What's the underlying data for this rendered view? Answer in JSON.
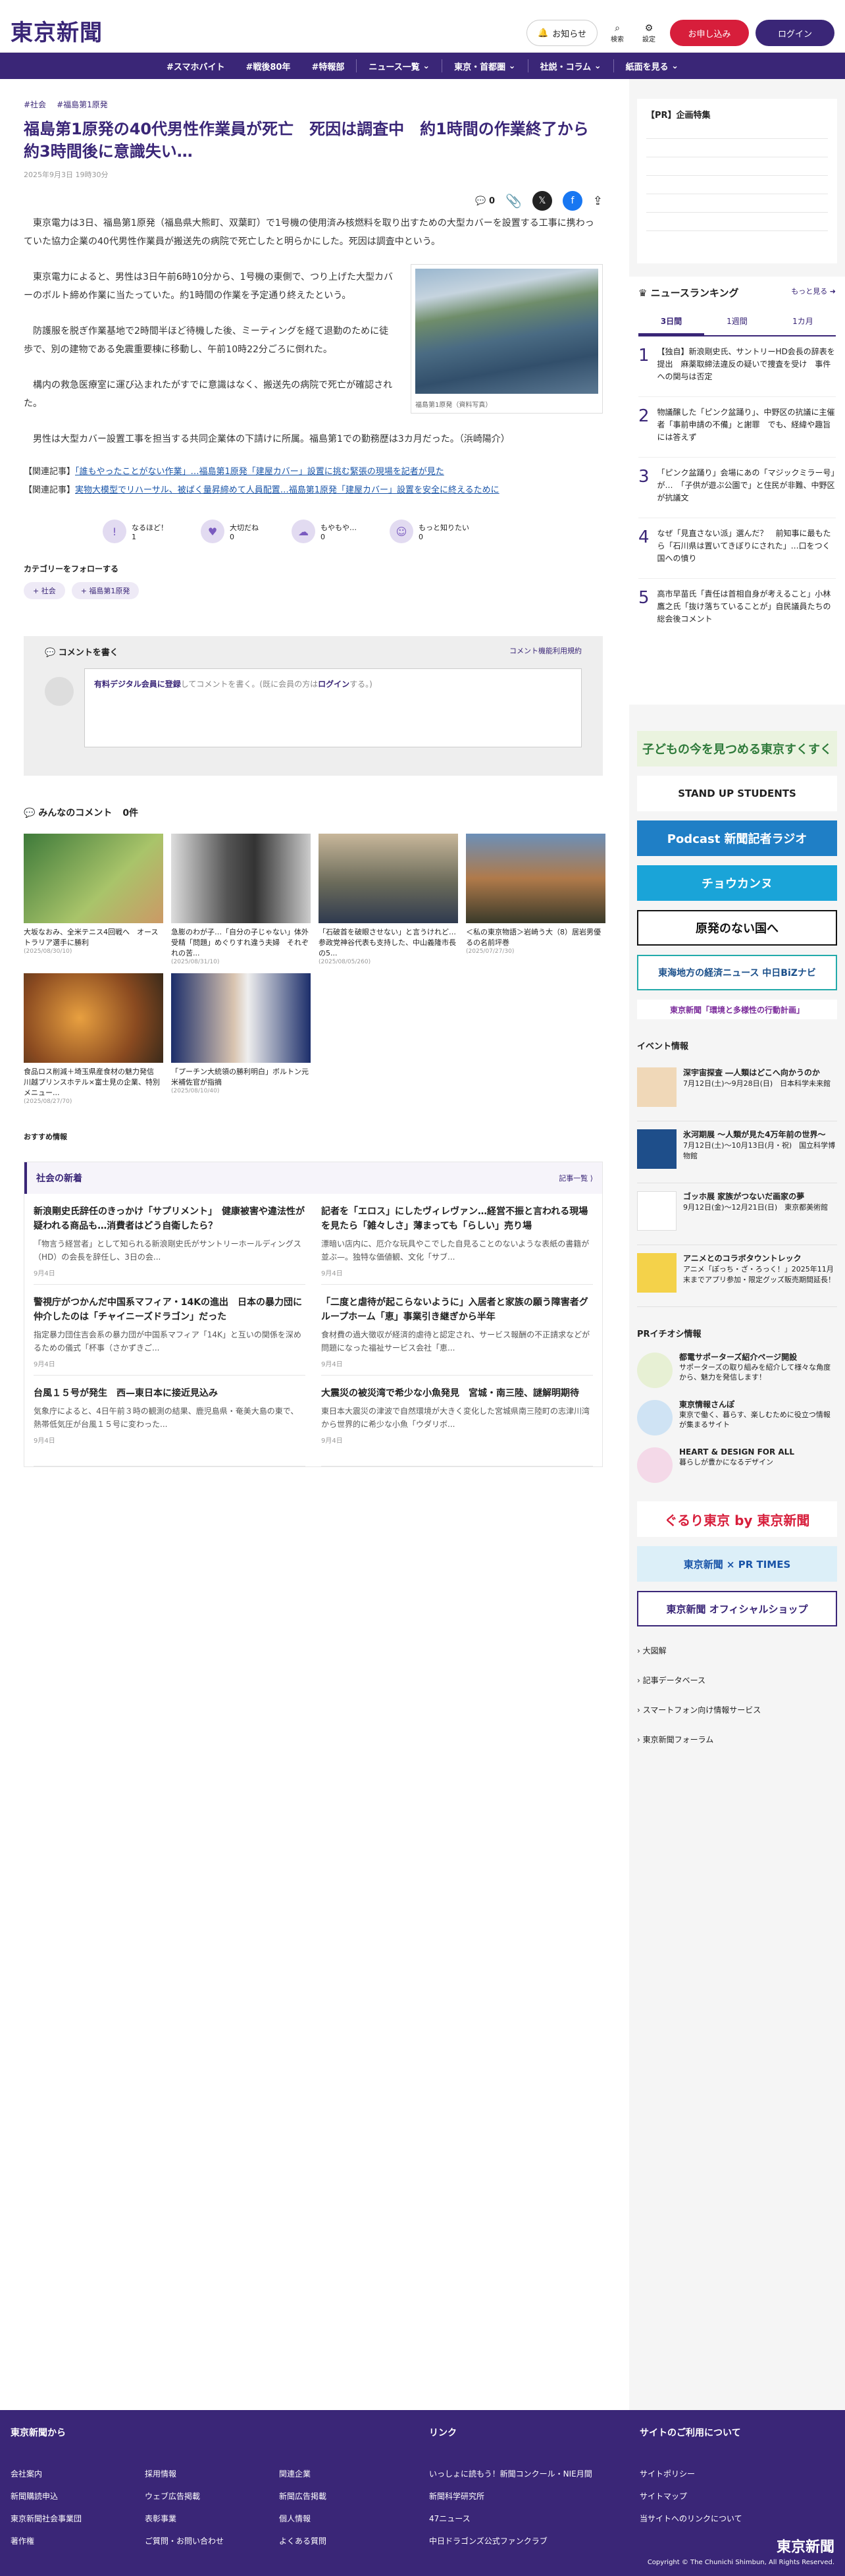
{
  "header": {
    "notif": "お知らせ",
    "search": "検索",
    "settings": "設定",
    "signup": "お申し込み",
    "login": "ログイン",
    "logo": "東京新聞"
  },
  "nav": [
    "#スマホバイト",
    "#戦後80年",
    "#特報部",
    "ニュース一覧",
    "東京・首都圏",
    "社説・コラム",
    "紙面を見る"
  ],
  "article": {
    "tags": [
      "#社会",
      "#福島第1原発"
    ],
    "title": "福島第1原発の40代男性作業員が死亡　死因は調査中　約1時間の作業終了から約3時間後に意識失い…",
    "date": "2025年9月3日 19時30分",
    "comment_count": "0",
    "p": [
      "東京電力は3日、福島第1原発（福島県大熊町、双葉町）で1号機の使用済み核燃料を取り出すための大型カバーを設置する工事に携わっていた協力企業の40代男性作業員が搬送先の病院で死亡したと明らかにした。死因は調査中という。",
      "東京電力によると、男性は3日午前6時10分から、1号機の東側で、つり上げた大型カバーのボルト締め作業に当たっていた。約1時間の作業を予定通り終えたという。",
      "防護服を脱ぎ作業基地で2時間半ほど待機した後、ミーティングを経て退勤のために徒歩で、別の建物である免震重要棟に移動し、午前10時22分ごろに倒れた。",
      "構内の救急医療室に運び込まれたがすでに意識はなく、搬送先の病院で死亡が確認された。",
      "男性は大型カバー設置工事を担当する共同企業体の下請けに所属。福島第1での勤務歴は3カ月だった。（浜崎陽介）"
    ],
    "photo_caption": "福島第1原発（資料写真）",
    "related": [
      {
        "label": "【関連記事】",
        "link": "「誰もやったことがない作業」…福島第1原発「建屋カバー」設置に挑む緊張の現場を記者が見た"
      },
      {
        "label": "【関連記事】",
        "link": "実物大模型でリハーサル、被ばく量昇締めて人員配置…福島第1原発「建屋カバー」設置を安全に終えるために"
      }
    ]
  },
  "reactions": [
    {
      "label": "なるほど！",
      "count": "1"
    },
    {
      "label": "大切だね",
      "count": "0"
    },
    {
      "label": "もやもや…",
      "count": "0"
    },
    {
      "label": "もっと知りたい",
      "count": "0"
    }
  ],
  "follow": {
    "title": "カテゴリーをフォローする",
    "chips": [
      "+ 社会",
      "+ 福島第1原発"
    ]
  },
  "comment": {
    "title": "コメントを書く",
    "rules": "コメント機能利用規約",
    "prompt_a": "有料デジタル会員に登録",
    "prompt_b": "してコメントを書く。(既に会員の方は",
    "prompt_c": "ログイン",
    "prompt_d": "する。)"
  },
  "everyone": {
    "title": "みんなのコメント",
    "count": "0件"
  },
  "cards": [
    {
      "t": "大坂なおみ、全米テニス4回戦へ　オーストラリア選手に勝利",
      "d": "(2025/08/30/10)"
    },
    {
      "t": "急膨のわが子…「自分の子じゃない」体外受精「問題」めぐりすれ違う夫婦　それぞれの苦...",
      "d": "(2025/08/31/10)"
    },
    {
      "t": "「石破首を破眼させない」と言うけれど…　参政党神谷代表も支持した、中山義隆市長の5...",
      "d": "(2025/08/05/260)"
    },
    {
      "t": "＜私の東京物語＞岩崎う大（8）居岩男優るの名前坪巻",
      "d": "(2025/07/27/30)"
    },
    {
      "t": "食品ロス削減＋埼玉県産食材の魅力発信　川越プリンスホテル×富士見の企業、特別メニュー...",
      "d": "(2025/08/27/70)"
    },
    {
      "t": "「プーチン大統領の勝利明白」ボルトン元米補佐官が指摘",
      "d": "(2025/08/10/40)"
    }
  ],
  "rec": "おすすめ情報",
  "news": {
    "title": "社会の新着",
    "more": "記事一覧",
    "items": [
      {
        "t": "新浪剛史氏辞任のきっかけ「サプリメント」　健康被害や違法性が疑われる商品も…消費者はどう自衛したら？",
        "d": "「物言う経営者」として知られる新浪剛史氏がサントリーホールディングス（HD）の会長を辞任し、3日の会...",
        "dt": "9月4日"
      },
      {
        "t": "記者を「エロス」にしたヴィレヴァン…経営不振と言われる現場を見たら「雑々しさ」薄まっても「らしい」売り場",
        "d": "漂暗い店内に、厄介な玩具やこでした自見ることのないような表紙の書籍が並ぶ—。独特な価値観、文化「サブ...",
        "dt": "9月4日"
      },
      {
        "t": "警視庁がつかんだ中国系マフィア・14Kの進出　日本の暴力団に仲介したのは「チャイニーズドラゴン」だった",
        "d": "指定暴力団住吉会系の暴力団が中国系マフィア「14K」と互いの関係を深めるための儀式「杯事（さかずきご...",
        "dt": "9月4日"
      },
      {
        "t": "「二度と虐待が起こらないように」入居者と家族の願う障害者グループホーム「恵」事業引き継ぎから半年",
        "d": "食材費の過大徴収が経済的虐待と認定され、サービス報酬の不正請求などが問題になった福祉サービス会社「恵...",
        "dt": "9月4日"
      },
      {
        "t": "台風１５号が発生　西—東日本に接近見込み",
        "d": "気象庁によると、4日午前３時の観測の結果、鹿児島県・奄美大島の東で、熱帯低気圧が台風１５号に変わった...",
        "dt": "9月4日"
      },
      {
        "t": "大震災の被災湾で希少な小魚発見　宮城・南三陸、謎解明期待",
        "d": "東日本大震災の津波で自然環境が大きく変化した宮城県南三陸町の志津川湾から世界的に希少な小魚「ウダリボ...",
        "dt": "9月4日"
      }
    ]
  },
  "side": {
    "pr_title": "【PR】企画特集",
    "ranking_title": "ニュースランキング",
    "ranking_more": "もっと見る",
    "tabs": [
      "3日間",
      "1週間",
      "1カ月"
    ],
    "ranks": [
      "【独自】新浪剛史氏、サントリーHD会長の辞表を提出　麻薬取締法違反の疑いで捜査を受け　事件への関与は否定",
      "物議醸した「ピンク盆踊り」、中野区の抗議に主催者「事前申請の不備」と謝罪　でも、経緯や趣旨には答えず",
      "「ピンク盆踊り」会場にあの「マジックミラー号」が…　「子供が遊ぶ公園で」と住民が非難、中野区が抗議文",
      "なぜ「見直さない派」選んだ？　前知事に最もたら「石川県は置いてきぼりにされた」…口をつく国への憤り",
      "高市早苗氏「責任は首相自身が考えること」小林鷹之氏「抜け落ちていることが」自民議員たちの総会後コメント"
    ],
    "banners": [
      "子どもの今を見つめる東京すくすく",
      "STAND UP STUDENTS",
      "Podcast 新聞記者ラジオ",
      "チョウカンヌ",
      "原発のない国へ",
      "東海地方の経済ニュース 中日BiZナビ",
      "東京新聞「環境と多様性の行動計画」"
    ],
    "ev_title": "イベント情報",
    "events": [
      {
        "t": "深宇宙探査 ―人類はどこへ向かうのか",
        "d": "7月12日(土)〜9月28日(日)　日本科学未来館"
      },
      {
        "t": "氷河期展 ～人類が見た4万年前の世界～",
        "d": "7月12日(土)〜10月13日(月・祝)　国立科学博物館"
      },
      {
        "t": "ゴッホ展 家族がつないだ画家の夢",
        "d": "9月12日(金)〜12月21日(日)　東京都美術館"
      },
      {
        "t": "アニメとのコラボタウントレック",
        "d": "アニメ「ぽっち・ざ・ろっく！」2025年11月末までアプリ参加・限定グッズ販売期間延長！"
      }
    ],
    "pr2_title": "PRイチオシ情報",
    "pr2": [
      {
        "t": "都電サポーターズ紹介ページ開設",
        "d": "サポーターズの取り組みを紹介して様々な角度から、魅力を発信します！"
      },
      {
        "t": "東京情報さんぽ",
        "d": "東京で働く、暮らす、楽しむために役立つ情報が集まるサイト"
      },
      {
        "t": "HEART & DESIGN FOR ALL",
        "d": "暮らしが豊かになるデザイン"
      }
    ],
    "banners2": [
      "ぐるり東京 by 東京新聞",
      "東京新聞 × PR TIMES",
      "東京新聞 オフィシャルショップ"
    ],
    "links": [
      "大図解",
      "記事データベース",
      "スマートフォン向け情報サービス",
      "東京新聞フォーラム"
    ]
  },
  "footer": {
    "c1": "東京新聞から",
    "c2": "リンク",
    "c3": "サイトのご利用について",
    "col1a": [
      "会社案内",
      "新聞購読申込",
      "東京新聞社会事業団",
      "著作権"
    ],
    "col1b": [
      "採用情報",
      "ウェブ広告掲載",
      "表彰事業",
      "ご質問・お問い合わせ"
    ],
    "col1c": [
      "関連企業",
      "新聞広告掲載",
      "個人情報",
      "よくある質問"
    ],
    "col2": [
      "いっしょに読もう！新聞コンクール・NIE月間",
      "新聞科学研究所",
      "47ニュース",
      "中日ドラゴンズ公式ファンクラブ"
    ],
    "col3": [
      "サイトポリシー",
      "サイトマップ",
      "当サイトへのリンクについて"
    ],
    "copy": "Copyright © The Chunichi Shimbun, All Rights Reserved.",
    "logo": "東京新聞"
  }
}
